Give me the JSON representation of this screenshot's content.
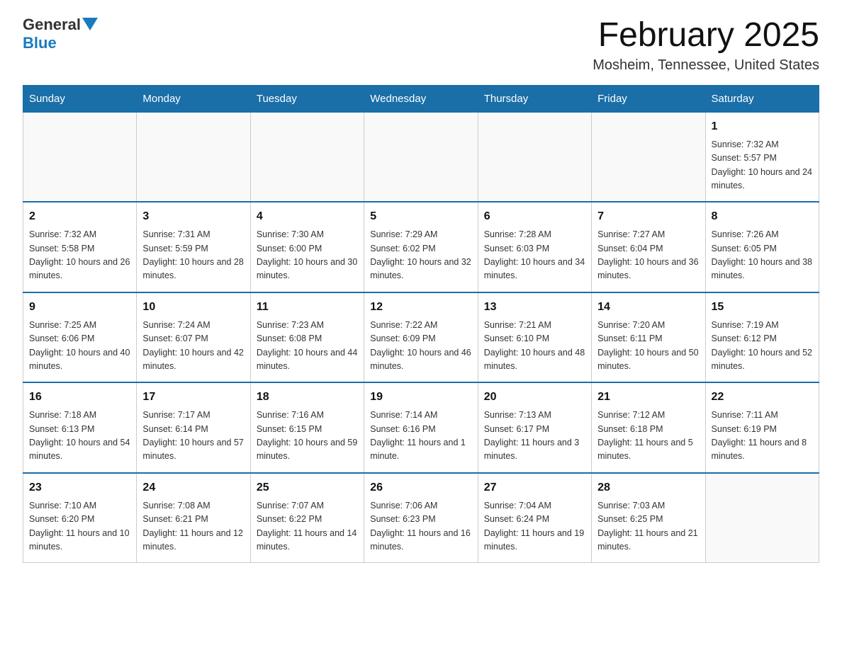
{
  "header": {
    "logo_general": "General",
    "logo_blue": "Blue",
    "title": "February 2025",
    "subtitle": "Mosheim, Tennessee, United States"
  },
  "days_of_week": [
    "Sunday",
    "Monday",
    "Tuesday",
    "Wednesday",
    "Thursday",
    "Friday",
    "Saturday"
  ],
  "weeks": [
    [
      {
        "day": "",
        "info": ""
      },
      {
        "day": "",
        "info": ""
      },
      {
        "day": "",
        "info": ""
      },
      {
        "day": "",
        "info": ""
      },
      {
        "day": "",
        "info": ""
      },
      {
        "day": "",
        "info": ""
      },
      {
        "day": "1",
        "info": "Sunrise: 7:32 AM\nSunset: 5:57 PM\nDaylight: 10 hours and 24 minutes."
      }
    ],
    [
      {
        "day": "2",
        "info": "Sunrise: 7:32 AM\nSunset: 5:58 PM\nDaylight: 10 hours and 26 minutes."
      },
      {
        "day": "3",
        "info": "Sunrise: 7:31 AM\nSunset: 5:59 PM\nDaylight: 10 hours and 28 minutes."
      },
      {
        "day": "4",
        "info": "Sunrise: 7:30 AM\nSunset: 6:00 PM\nDaylight: 10 hours and 30 minutes."
      },
      {
        "day": "5",
        "info": "Sunrise: 7:29 AM\nSunset: 6:02 PM\nDaylight: 10 hours and 32 minutes."
      },
      {
        "day": "6",
        "info": "Sunrise: 7:28 AM\nSunset: 6:03 PM\nDaylight: 10 hours and 34 minutes."
      },
      {
        "day": "7",
        "info": "Sunrise: 7:27 AM\nSunset: 6:04 PM\nDaylight: 10 hours and 36 minutes."
      },
      {
        "day": "8",
        "info": "Sunrise: 7:26 AM\nSunset: 6:05 PM\nDaylight: 10 hours and 38 minutes."
      }
    ],
    [
      {
        "day": "9",
        "info": "Sunrise: 7:25 AM\nSunset: 6:06 PM\nDaylight: 10 hours and 40 minutes."
      },
      {
        "day": "10",
        "info": "Sunrise: 7:24 AM\nSunset: 6:07 PM\nDaylight: 10 hours and 42 minutes."
      },
      {
        "day": "11",
        "info": "Sunrise: 7:23 AM\nSunset: 6:08 PM\nDaylight: 10 hours and 44 minutes."
      },
      {
        "day": "12",
        "info": "Sunrise: 7:22 AM\nSunset: 6:09 PM\nDaylight: 10 hours and 46 minutes."
      },
      {
        "day": "13",
        "info": "Sunrise: 7:21 AM\nSunset: 6:10 PM\nDaylight: 10 hours and 48 minutes."
      },
      {
        "day": "14",
        "info": "Sunrise: 7:20 AM\nSunset: 6:11 PM\nDaylight: 10 hours and 50 minutes."
      },
      {
        "day": "15",
        "info": "Sunrise: 7:19 AM\nSunset: 6:12 PM\nDaylight: 10 hours and 52 minutes."
      }
    ],
    [
      {
        "day": "16",
        "info": "Sunrise: 7:18 AM\nSunset: 6:13 PM\nDaylight: 10 hours and 54 minutes."
      },
      {
        "day": "17",
        "info": "Sunrise: 7:17 AM\nSunset: 6:14 PM\nDaylight: 10 hours and 57 minutes."
      },
      {
        "day": "18",
        "info": "Sunrise: 7:16 AM\nSunset: 6:15 PM\nDaylight: 10 hours and 59 minutes."
      },
      {
        "day": "19",
        "info": "Sunrise: 7:14 AM\nSunset: 6:16 PM\nDaylight: 11 hours and 1 minute."
      },
      {
        "day": "20",
        "info": "Sunrise: 7:13 AM\nSunset: 6:17 PM\nDaylight: 11 hours and 3 minutes."
      },
      {
        "day": "21",
        "info": "Sunrise: 7:12 AM\nSunset: 6:18 PM\nDaylight: 11 hours and 5 minutes."
      },
      {
        "day": "22",
        "info": "Sunrise: 7:11 AM\nSunset: 6:19 PM\nDaylight: 11 hours and 8 minutes."
      }
    ],
    [
      {
        "day": "23",
        "info": "Sunrise: 7:10 AM\nSunset: 6:20 PM\nDaylight: 11 hours and 10 minutes."
      },
      {
        "day": "24",
        "info": "Sunrise: 7:08 AM\nSunset: 6:21 PM\nDaylight: 11 hours and 12 minutes."
      },
      {
        "day": "25",
        "info": "Sunrise: 7:07 AM\nSunset: 6:22 PM\nDaylight: 11 hours and 14 minutes."
      },
      {
        "day": "26",
        "info": "Sunrise: 7:06 AM\nSunset: 6:23 PM\nDaylight: 11 hours and 16 minutes."
      },
      {
        "day": "27",
        "info": "Sunrise: 7:04 AM\nSunset: 6:24 PM\nDaylight: 11 hours and 19 minutes."
      },
      {
        "day": "28",
        "info": "Sunrise: 7:03 AM\nSunset: 6:25 PM\nDaylight: 11 hours and 21 minutes."
      },
      {
        "day": "",
        "info": ""
      }
    ]
  ]
}
